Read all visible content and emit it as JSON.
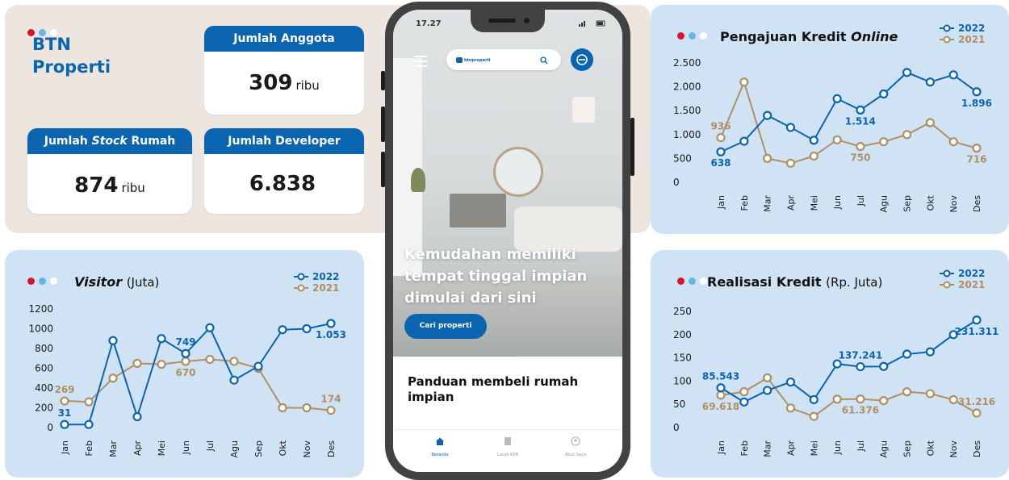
{
  "brand": {
    "line1": "BTN",
    "line2": "Properti"
  },
  "stats": {
    "anggota": {
      "label": "Jumlah Anggota",
      "value": "309",
      "unit": "ribu"
    },
    "stock": {
      "label_a": "Jumlah ",
      "label_b": "Stock",
      "label_c": " Rumah",
      "value": "874",
      "unit": "ribu"
    },
    "developer": {
      "label": "Jumlah Developer",
      "value": "6.838"
    }
  },
  "colors": {
    "y2022": "#0b64b0",
    "y2021": "#b08f62",
    "accent_red": "#d7152a",
    "panel_blue": "#cfe3f5",
    "panel_beige": "#ece6df"
  },
  "phone": {
    "time": "17.27",
    "search_logo": "btnproperti",
    "headline_line1": "Kemudahan memiliki",
    "headline_line2": "tempat tinggal impian",
    "headline_line3": "dimulai dari sini",
    "cta": "Cari properti",
    "guide_line1": "Panduan membeli rumah",
    "guide_line2": "impian",
    "tabs": [
      "Beranda",
      "Lacak KPR",
      "Akun Saya"
    ],
    "icons": [
      "menu-icon",
      "search-icon",
      "home-icon",
      "document-icon",
      "user-icon"
    ]
  },
  "chart_data": [
    {
      "id": "visitor",
      "type": "line",
      "title": "Visitor",
      "title_unit": "(Juta)",
      "categories": [
        "Jan",
        "Feb",
        "Mar",
        "Apr",
        "Mei",
        "Jun",
        "Jul",
        "Agu",
        "Sep",
        "Okt",
        "Nov",
        "Des"
      ],
      "yticks": [
        "0",
        "200",
        "400",
        "600",
        "800",
        "1000",
        "1200"
      ],
      "ylim": [
        0,
        1200
      ],
      "grid": false,
      "legend": "top-right",
      "series": [
        {
          "name": "2022",
          "values": [
            31,
            31,
            880,
            110,
            900,
            749,
            1010,
            480,
            620,
            990,
            1000,
            1053
          ]
        },
        {
          "name": "2021",
          "values": [
            269,
            260,
            500,
            650,
            640,
            670,
            690,
            670,
            600,
            200,
            200,
            174
          ]
        }
      ],
      "labels": [
        {
          "series": 0,
          "index": 0,
          "text": "31",
          "pos": "above"
        },
        {
          "series": 0,
          "index": 5,
          "text": "749",
          "pos": "above"
        },
        {
          "series": 0,
          "index": 11,
          "text": "1.053",
          "pos": "below"
        },
        {
          "series": 1,
          "index": 0,
          "text": "269",
          "pos": "above"
        },
        {
          "series": 1,
          "index": 5,
          "text": "670",
          "pos": "below"
        },
        {
          "series": 1,
          "index": 11,
          "text": "174",
          "pos": "above"
        }
      ]
    },
    {
      "id": "pengajuan",
      "type": "line",
      "title": "Pengajuan Kredit ",
      "title_em": "Online",
      "categories": [
        "Jan",
        "Feb",
        "Mar",
        "Apr",
        "Mei",
        "Jun",
        "Jul",
        "Agu",
        "Sep",
        "Okt",
        "Nov",
        "Des"
      ],
      "yticks": [
        "0",
        "500",
        "1.000",
        "1.500",
        "2.000",
        "2.500"
      ],
      "ylim": [
        0,
        2500
      ],
      "grid": false,
      "legend": "top-right",
      "series": [
        {
          "name": "2022",
          "values": [
            638,
            860,
            1400,
            1150,
            880,
            1750,
            1514,
            1850,
            2300,
            2100,
            2250,
            1896
          ]
        },
        {
          "name": "2021",
          "values": [
            936,
            2100,
            500,
            400,
            550,
            890,
            750,
            850,
            1000,
            1250,
            850,
            716
          ]
        }
      ],
      "labels": [
        {
          "series": 0,
          "index": 0,
          "text": "638",
          "pos": "below"
        },
        {
          "series": 0,
          "index": 6,
          "text": "1.514",
          "pos": "below"
        },
        {
          "series": 0,
          "index": 11,
          "text": "1.896",
          "pos": "below"
        },
        {
          "series": 1,
          "index": 0,
          "text": "936",
          "pos": "above"
        },
        {
          "series": 1,
          "index": 6,
          "text": "750",
          "pos": "below"
        },
        {
          "series": 1,
          "index": 11,
          "text": "716",
          "pos": "below"
        }
      ]
    },
    {
      "id": "realisasi",
      "type": "line",
      "title": "Realisasi Kredit",
      "title_unit": "(Rp. Juta)",
      "categories": [
        "Jan",
        "Feb",
        "Mar",
        "Apr",
        "Mei",
        "Jun",
        "Jul",
        "Agu",
        "Sep",
        "Okt",
        "Nov",
        "Des"
      ],
      "yticks": [
        "0",
        "50",
        "100",
        "150",
        "200",
        "250"
      ],
      "ylim": [
        0,
        250
      ],
      "grid": false,
      "legend": "top-right",
      "series": [
        {
          "name": "2022",
          "values": [
            85.543,
            55,
            80,
            98,
            60,
            137,
            131,
            131.5,
            158,
            163,
            200,
            231.311
          ]
        },
        {
          "name": "2021",
          "values": [
            69.618,
            77,
            107,
            42,
            24,
            61,
            61.376,
            58,
            77,
            73,
            60,
            31.216
          ]
        }
      ],
      "labels": [
        {
          "series": 0,
          "index": 0,
          "text": "85.543",
          "pos": "above"
        },
        {
          "series": 0,
          "index": 6,
          "text": "137.241",
          "pos": "above"
        },
        {
          "series": 0,
          "index": 11,
          "text": "231.311",
          "pos": "below"
        },
        {
          "series": 1,
          "index": 0,
          "text": "69.618",
          "pos": "below"
        },
        {
          "series": 1,
          "index": 6,
          "text": "61.376",
          "pos": "below"
        },
        {
          "series": 1,
          "index": 11,
          "text": "31.216",
          "pos": "above"
        }
      ]
    }
  ]
}
